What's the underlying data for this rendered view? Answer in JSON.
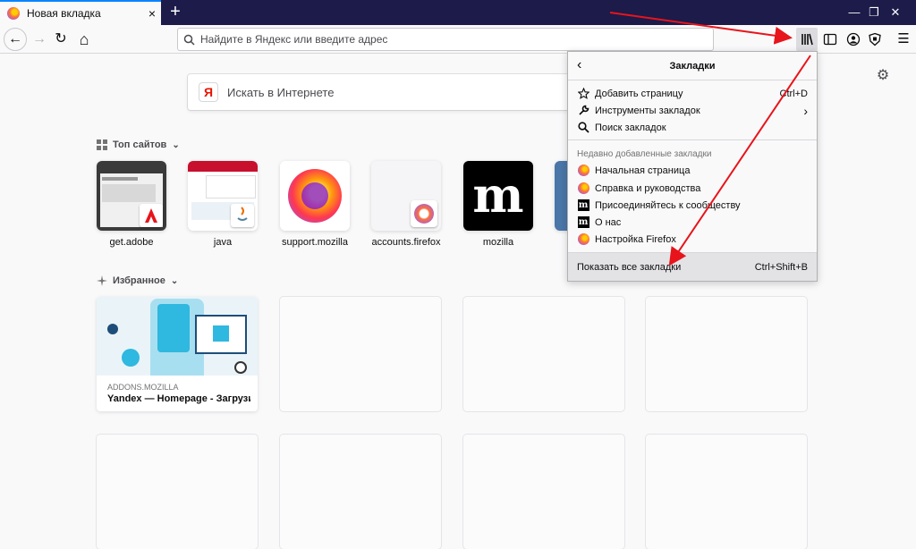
{
  "tab": {
    "title": "Новая вкладка",
    "close": "×"
  },
  "newtab_label": "+",
  "window_controls": {
    "minimize": "—",
    "restore": "❐",
    "close": "✕"
  },
  "nav": {
    "back": "←",
    "forward": "→",
    "reload": "↻",
    "home": "⌂",
    "menu": "☰"
  },
  "urlbar": {
    "placeholder": "Найдите в Яндекс или введите адрес"
  },
  "search": {
    "logo": "Я",
    "placeholder": "Искать в Интернете"
  },
  "top_sites": {
    "title": "Топ сайтов",
    "tiles": [
      {
        "label": "get.adobe"
      },
      {
        "label": "java"
      },
      {
        "label": "support.mozilla"
      },
      {
        "label": "accounts.firefox"
      },
      {
        "label": "mozilla",
        "glyph": "m"
      }
    ]
  },
  "highlights": {
    "title": "Избранное",
    "card": {
      "source": "ADDONS.MOZILLA",
      "title": "Yandex — Homepage - Загрузит…"
    }
  },
  "bookmarks_panel": {
    "title": "Закладки",
    "items": [
      {
        "label": "Добавить страницу",
        "shortcut": "Ctrl+D",
        "icon": "star-icon"
      },
      {
        "label": "Инструменты закладок",
        "shortcut": "›",
        "icon": "wrench-icon"
      },
      {
        "label": "Поиск закладок",
        "shortcut": "",
        "icon": "search-icon"
      }
    ],
    "recent_header": "Недавно добавленные закладки",
    "recent": [
      {
        "label": "Начальная страница",
        "icon": "firefox-icon"
      },
      {
        "label": "Справка и руководства",
        "icon": "firefox-icon"
      },
      {
        "label": "Присоединяйтесь к сообществу",
        "icon": "mozilla-icon"
      },
      {
        "label": "О нас",
        "icon": "mozilla-icon"
      },
      {
        "label": "Настройка Firefox",
        "icon": "firefox-icon"
      }
    ],
    "footer": {
      "label": "Показать все закладки",
      "shortcut": "Ctrl+Shift+B"
    }
  },
  "colors": {
    "titlebar": "#1c1b4a",
    "accent": "#0a84ff",
    "annotation_arrow": "#e8141b"
  }
}
